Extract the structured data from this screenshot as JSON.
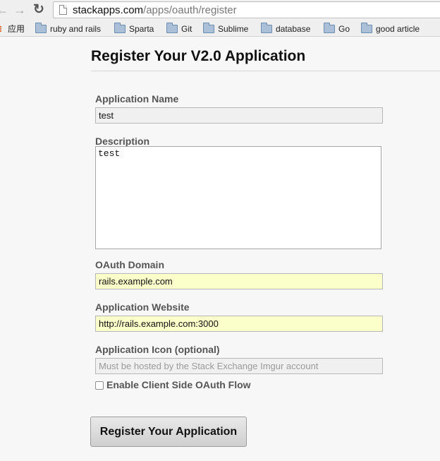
{
  "browser": {
    "nav": {
      "back": "←",
      "forward": "→",
      "reload": "↻"
    },
    "url_host": "stackapps.com",
    "url_path": "/apps/oauth/register"
  },
  "bookmarks": [
    {
      "label": "应用",
      "icon": "apps-grid-icon"
    },
    {
      "label": "ruby and rails",
      "icon": "folder-icon"
    },
    {
      "label": "Sparta",
      "icon": "folder-icon"
    },
    {
      "label": "Git",
      "icon": "folder-icon"
    },
    {
      "label": "Sublime",
      "icon": "folder-icon"
    },
    {
      "label": "database",
      "icon": "folder-icon"
    },
    {
      "label": "Go",
      "icon": "folder-icon"
    },
    {
      "label": "good article",
      "icon": "folder-icon"
    }
  ],
  "page": {
    "title": "Register Your V2.0 Application",
    "fields": {
      "app_name": {
        "label": "Application Name",
        "value": "test"
      },
      "description": {
        "label": "Description",
        "value": "test"
      },
      "oauth_domain": {
        "label": "OAuth Domain",
        "value": "rails.example.com"
      },
      "website": {
        "label": "Application Website",
        "value": "http://rails.example.com:3000"
      },
      "icon": {
        "label": "Application Icon (optional)",
        "placeholder": "Must be hosted by the Stack Exchange Imgur account",
        "value": ""
      }
    },
    "client_side_flow": {
      "label": "Enable Client Side OAuth Flow",
      "checked": false
    },
    "submit_label": "Register Your Application"
  },
  "colors": {
    "autofill": "#fbffc9",
    "folder": "#a9c0d8"
  }
}
